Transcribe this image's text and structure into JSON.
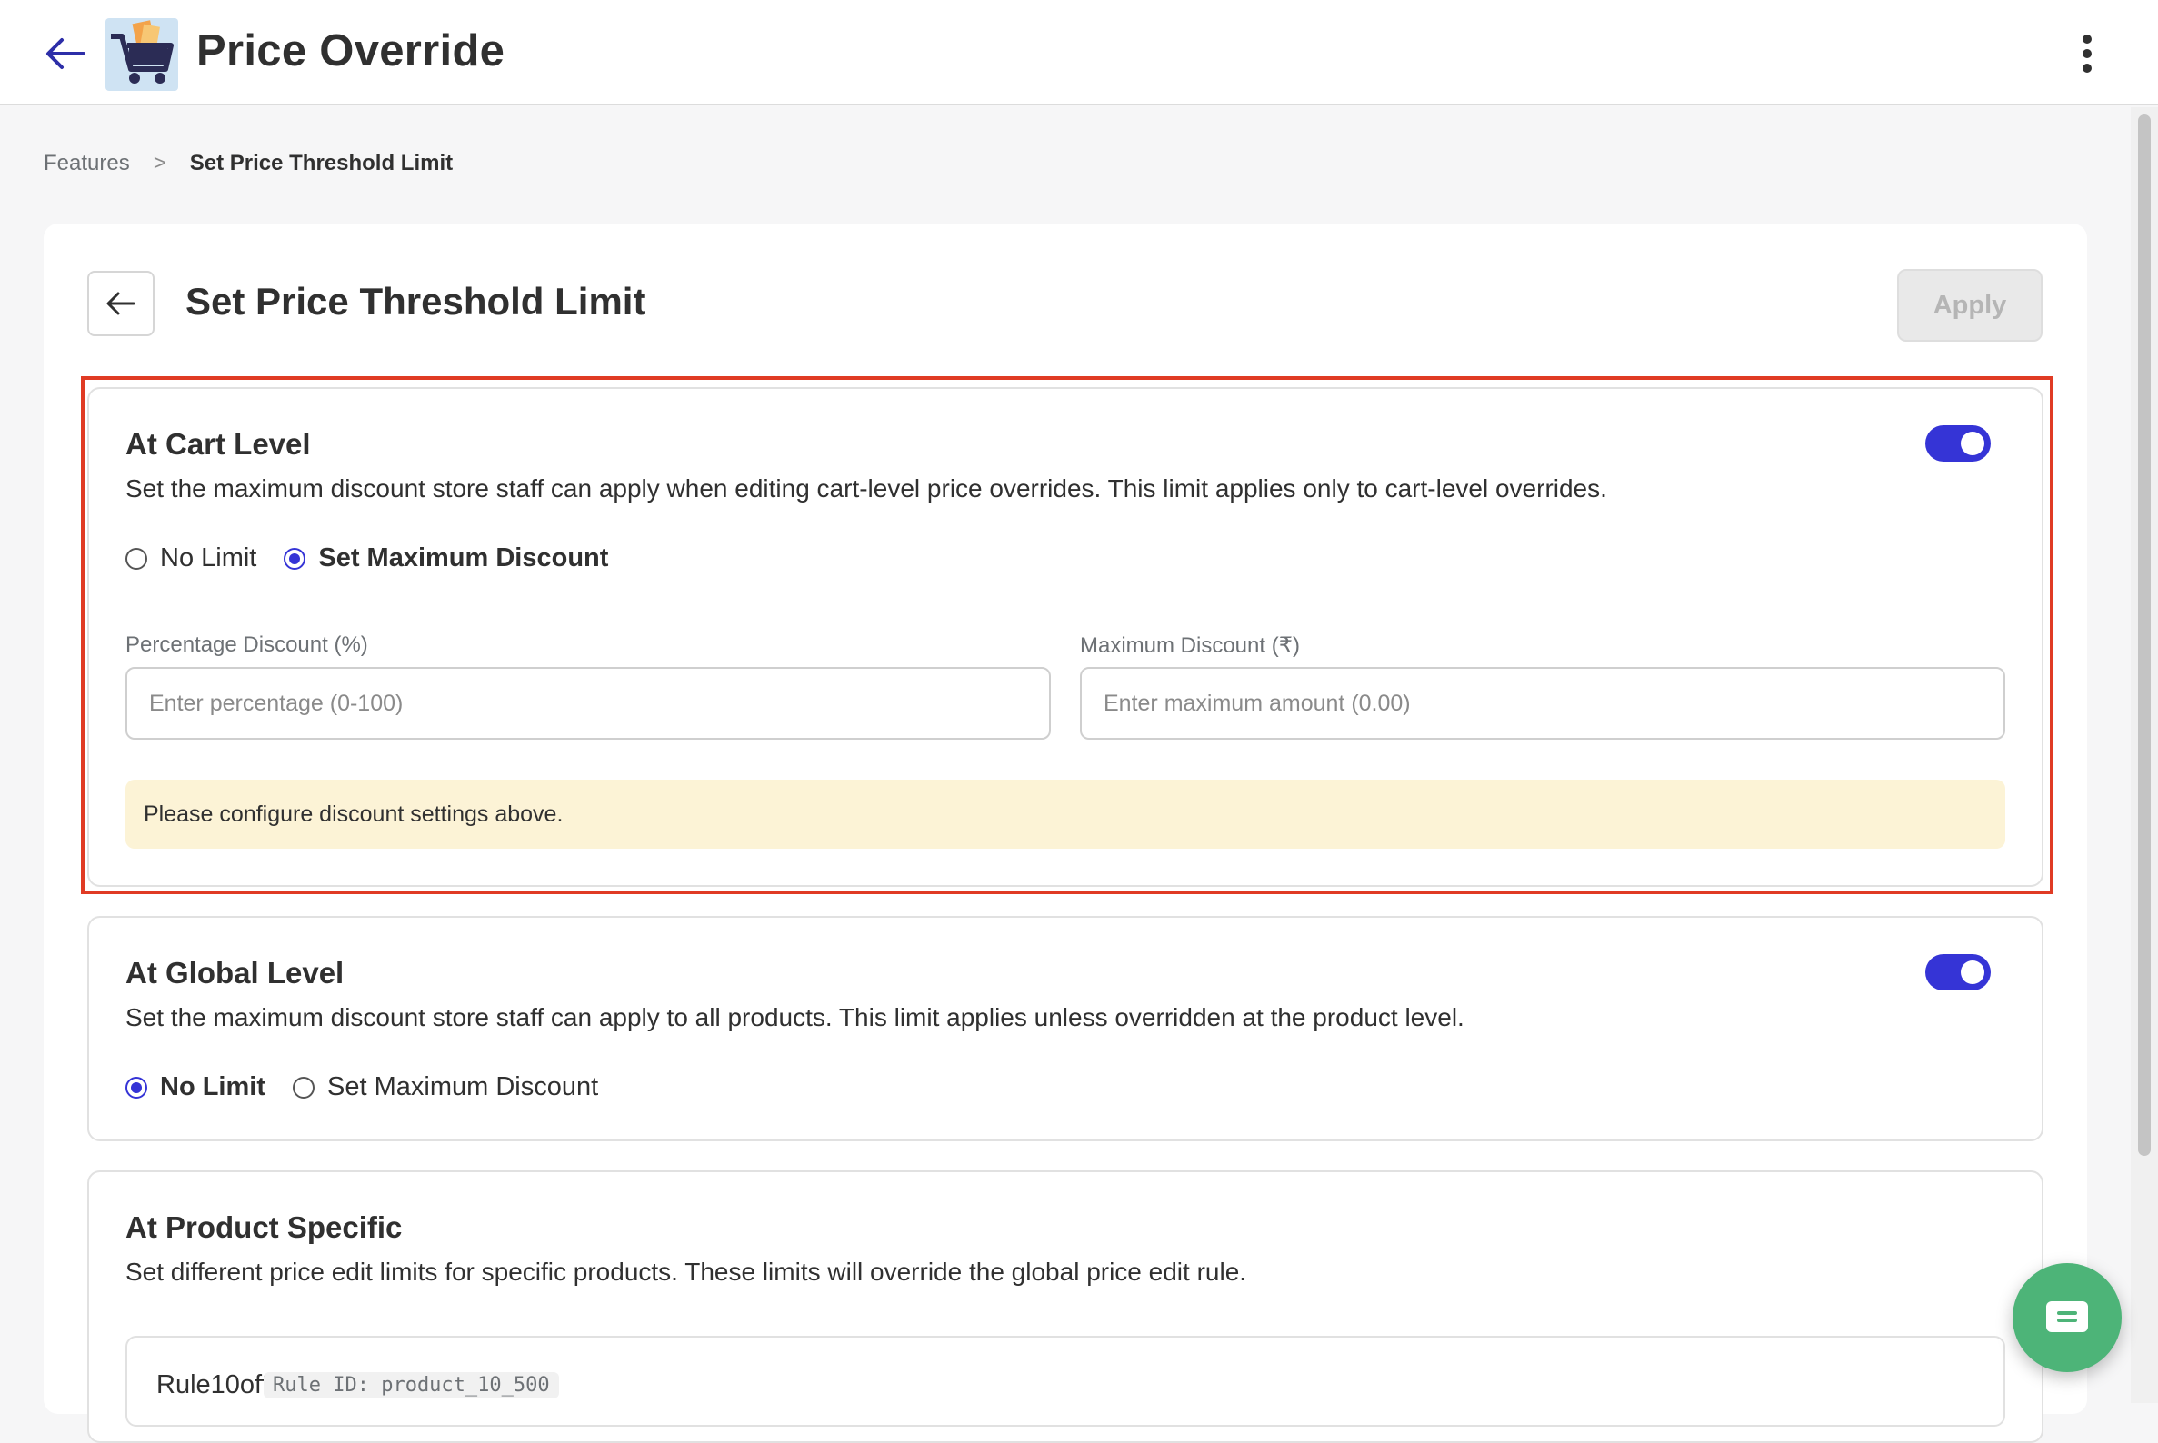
{
  "header": {
    "app_title": "Price Override",
    "menu_icon": "more-vertical-icon",
    "back_icon": "arrow-left-icon"
  },
  "breadcrumb": {
    "parent": "Features",
    "separator": ">",
    "current": "Set Price Threshold Limit"
  },
  "page": {
    "title": "Set Price Threshold Limit",
    "apply_label": "Apply"
  },
  "cart_level": {
    "title": "At Cart Level",
    "description": "Set the maximum discount store staff can apply when editing cart-level price overrides. This limit applies only to cart-level overrides.",
    "enabled": true,
    "options": [
      "No Limit",
      "Set Maximum Discount"
    ],
    "selected": "Set Maximum Discount",
    "percentage_label": "Percentage Discount (%)",
    "percentage_placeholder": "Enter percentage (0-100)",
    "maximum_label": "Maximum Discount (₹)",
    "maximum_placeholder": "Enter maximum amount (0.00)",
    "notice": "Please configure discount settings above."
  },
  "global_level": {
    "title": "At Global Level",
    "description": "Set the maximum discount store staff can apply to all products. This limit applies unless overridden at the product level.",
    "enabled": true,
    "options": [
      "No Limit",
      "Set Maximum Discount"
    ],
    "selected": "No Limit"
  },
  "product_specific": {
    "title": "At Product Specific",
    "description": "Set different price edit limits for specific products. These limits will override the global price edit rule.",
    "rules": [
      {
        "name": "Rule10off",
        "id_label": "Rule ID: product_10_500"
      }
    ]
  },
  "colors": {
    "accent": "#3534d6",
    "highlight_border": "#e03b24",
    "notice_bg": "#fcf3d6",
    "chat_button": "#4db478"
  }
}
